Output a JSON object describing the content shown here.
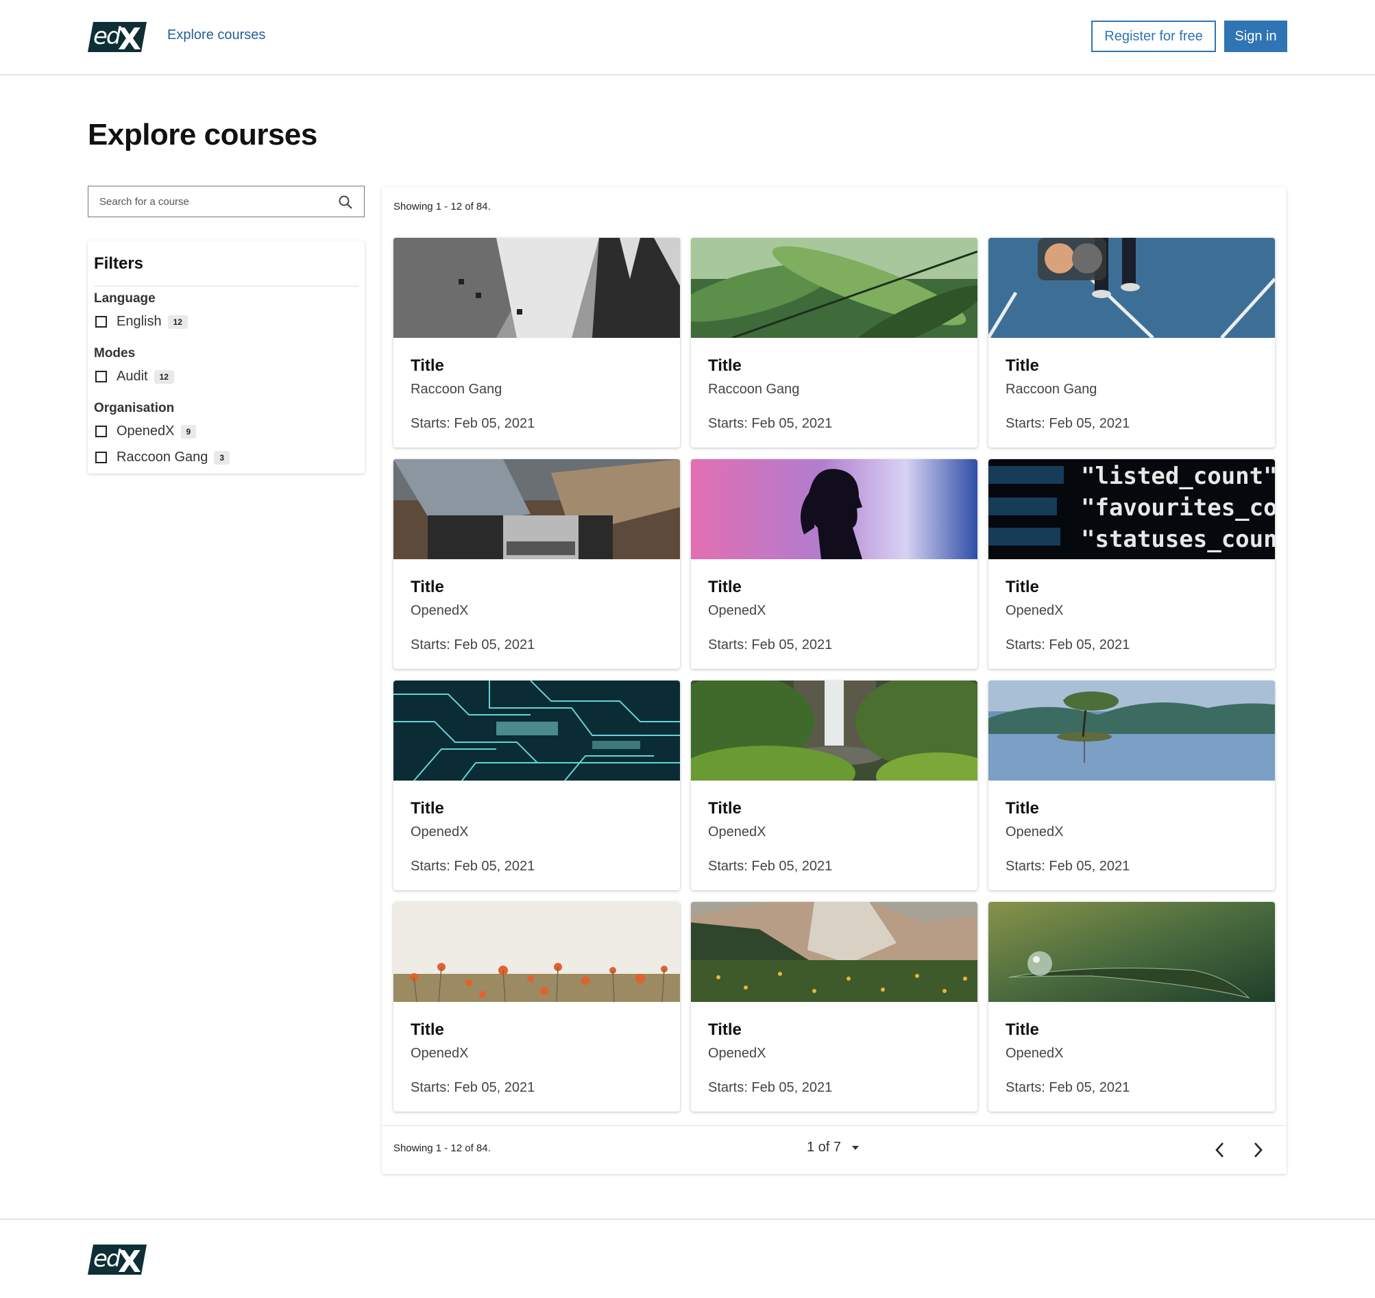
{
  "header": {
    "logo_text": "edX",
    "nav_link": "Explore courses",
    "register_label": "Register for free",
    "signin_label": "Sign in"
  },
  "page": {
    "title": "Explore courses"
  },
  "search": {
    "placeholder": "Search for a course"
  },
  "filters": {
    "title": "Filters",
    "groups": [
      {
        "label": "Language",
        "options": [
          {
            "label": "English",
            "count": "12"
          }
        ]
      },
      {
        "label": "Modes",
        "options": [
          {
            "label": "Audit",
            "count": "12"
          }
        ]
      },
      {
        "label": "Organisation",
        "options": [
          {
            "label": "OpenedX",
            "count": "9"
          },
          {
            "label": "Raccoon Gang",
            "count": "3"
          }
        ]
      }
    ]
  },
  "results": {
    "showing_text": "Showing 1 - 12 of 84.",
    "courses": [
      {
        "title": "Title",
        "org": "Raccoon Gang",
        "start": "Starts: Feb 05, 2021",
        "image": "architecture-grayscale"
      },
      {
        "title": "Title",
        "org": "Raccoon Gang",
        "start": "Starts: Feb 05, 2021",
        "image": "fern-leaves"
      },
      {
        "title": "Title",
        "org": "Raccoon Gang",
        "start": "Starts: Feb 05, 2021",
        "image": "blue-court-legs"
      },
      {
        "title": "Title",
        "org": "OpenedX",
        "start": "Starts: Feb 05, 2021",
        "image": "laptop-hands"
      },
      {
        "title": "Title",
        "org": "OpenedX",
        "start": "Starts: Feb 05, 2021",
        "image": "silhouette-gradient"
      },
      {
        "title": "Title",
        "org": "OpenedX",
        "start": "Starts: Feb 05, 2021",
        "image": "code-screen"
      },
      {
        "title": "Title",
        "org": "OpenedX",
        "start": "Starts: Feb 05, 2021",
        "image": "circuit-board"
      },
      {
        "title": "Title",
        "org": "OpenedX",
        "start": "Starts: Feb 05, 2021",
        "image": "waterfall-forest"
      },
      {
        "title": "Title",
        "org": "OpenedX",
        "start": "Starts: Feb 05, 2021",
        "image": "lake-tree"
      },
      {
        "title": "Title",
        "org": "OpenedX",
        "start": "Starts: Feb 05, 2021",
        "image": "poppy-field"
      },
      {
        "title": "Title",
        "org": "OpenedX",
        "start": "Starts: Feb 05, 2021",
        "image": "mountain-meadow"
      },
      {
        "title": "Title",
        "org": "OpenedX",
        "start": "Starts: Feb 05, 2021",
        "image": "water-droplet-leaf"
      }
    ],
    "code_lines": [
      "\"listed_count\":",
      "\"favourites_count\"",
      "\"statuses_count\""
    ],
    "pagination": {
      "current": "1 of 7"
    }
  },
  "colors": {
    "brand": "#2f74b5",
    "link": "#1f5f9a",
    "logo": "#0d2f35"
  }
}
